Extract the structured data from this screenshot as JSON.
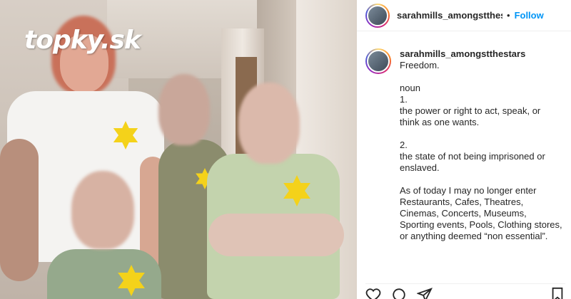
{
  "watermark": {
    "text": "topky.sk"
  },
  "header": {
    "username": "sarahmills_amongstthes",
    "separator": "•",
    "follow_label": "Follow"
  },
  "post": {
    "username": "sarahmills_amongstthestars",
    "caption": "Freedom.\n\nnoun\n1.\nthe power or right to act, speak, or think as one wants.\n\n2.\nthe state of not being imprisoned or enslaved.\n\nAs of today I may no longer enter Restaurants, Cafes, Theatres, Cinemas, Concerts, Museums, Sporting events, Pools, Clothing stores, or anything deemed “non essential”."
  },
  "actions": {
    "icons": [
      "heart-icon",
      "comment-icon",
      "share-icon",
      "bookmark-icon"
    ]
  },
  "colors": {
    "follow": "#0095f6",
    "star": "#f4d21a"
  }
}
